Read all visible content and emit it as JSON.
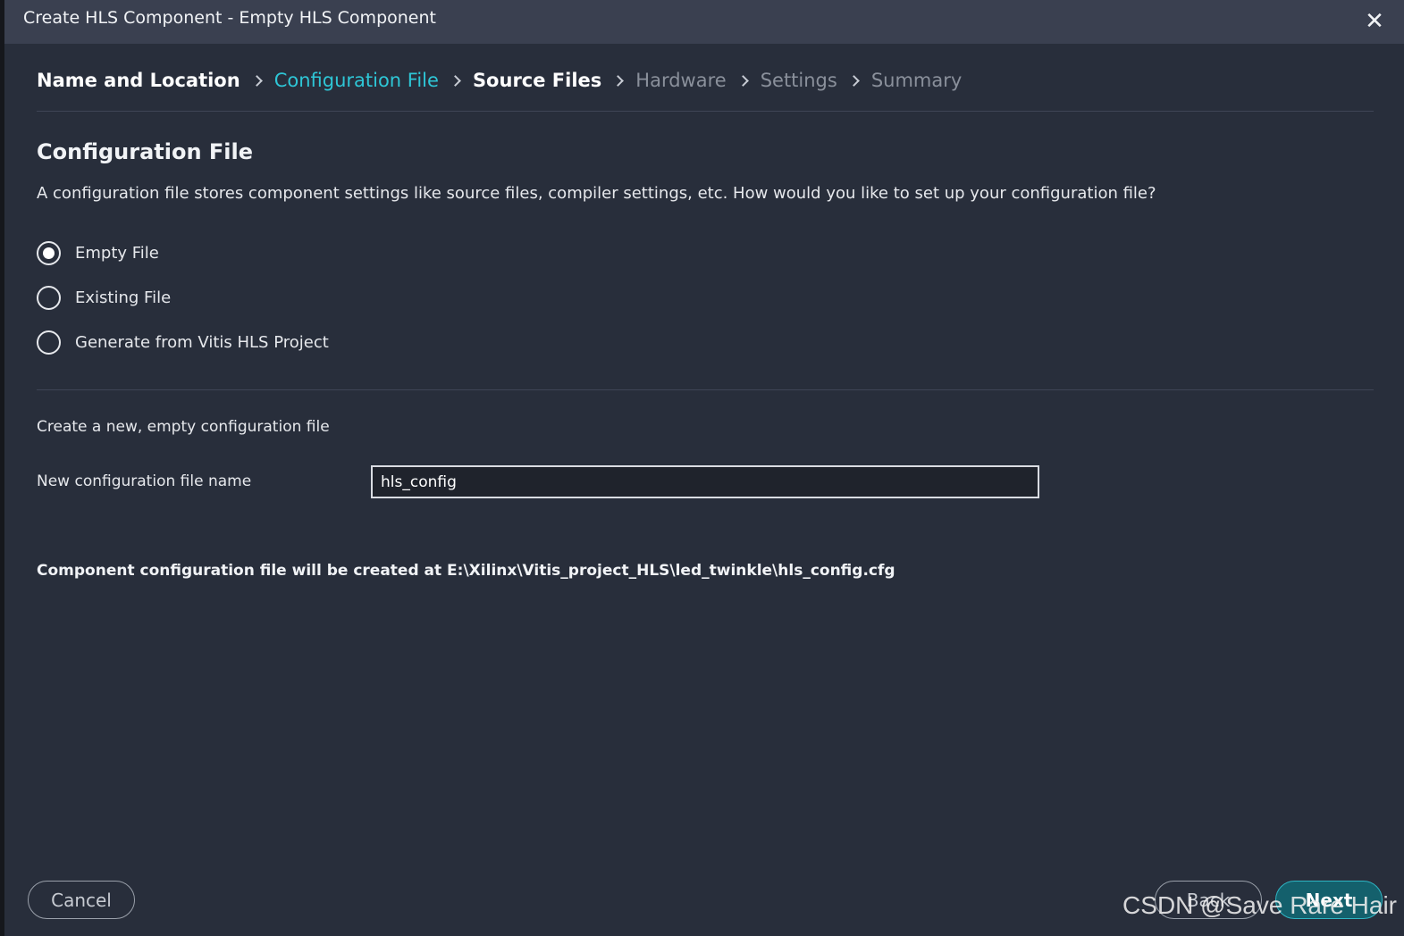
{
  "window": {
    "title": "Create HLS Component - Empty HLS Component",
    "close_glyph": "✕"
  },
  "breadcrumb": [
    {
      "label": "Name and Location",
      "state": "done"
    },
    {
      "label": "Configuration File",
      "state": "active"
    },
    {
      "label": "Source Files",
      "state": "next"
    },
    {
      "label": "Hardware",
      "state": "future"
    },
    {
      "label": "Settings",
      "state": "future"
    },
    {
      "label": "Summary",
      "state": "future"
    }
  ],
  "section": {
    "title": "Configuration File",
    "description": "A configuration file stores component settings like source files, compiler settings, etc. How would you like to set up your configuration file?"
  },
  "options": [
    {
      "label": "Empty File",
      "checked": true
    },
    {
      "label": "Existing File",
      "checked": false
    },
    {
      "label": "Generate from Vitis HLS Project",
      "checked": false
    }
  ],
  "new_file": {
    "description": "Create a new, empty configuration file",
    "field_label": "New configuration file name",
    "value": "hls_config"
  },
  "path_note": "Component configuration file will be created at E:\\Xilinx\\Vitis_project_HLS\\led_twinkle\\hls_config.cfg",
  "buttons": {
    "cancel": "Cancel",
    "back": "Back",
    "next": "Next"
  },
  "watermark": "CSDN @Save Rare Hair",
  "colors": {
    "accent": "#2ec6d6",
    "background": "#282e3b",
    "titlebar": "#3a4050",
    "next_button": "#14606c"
  }
}
